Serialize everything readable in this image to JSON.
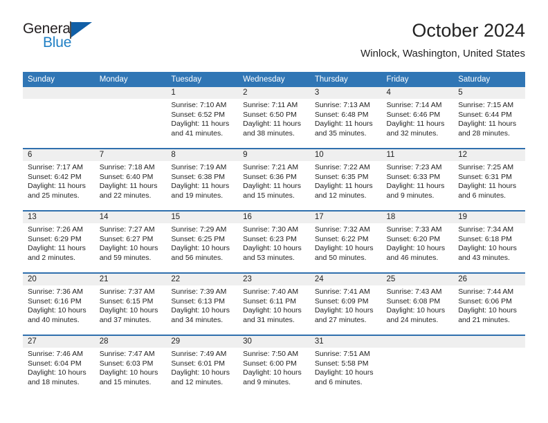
{
  "brand": {
    "name_part1": "General",
    "name_part2": "Blue",
    "flag_icon": "flag-triangle-icon"
  },
  "header": {
    "month_title": "October 2024",
    "location": "Winlock, Washington, United States"
  },
  "colors": {
    "header_blue": "#3076b5",
    "divider_blue": "#2f6fad",
    "daynum_band": "#efefef",
    "brand_blue": "#1f7fc4",
    "text": "#222222"
  },
  "calendar": {
    "weekday_headers": [
      "Sunday",
      "Monday",
      "Tuesday",
      "Wednesday",
      "Thursday",
      "Friday",
      "Saturday"
    ],
    "weeks": [
      [
        {
          "day": "",
          "empty": true,
          "sunrise": "",
          "sunset": "",
          "daylight": ""
        },
        {
          "day": "",
          "empty": true,
          "sunrise": "",
          "sunset": "",
          "daylight": ""
        },
        {
          "day": "1",
          "sunrise": "Sunrise: 7:10 AM",
          "sunset": "Sunset: 6:52 PM",
          "daylight": "Daylight: 11 hours and 41 minutes."
        },
        {
          "day": "2",
          "sunrise": "Sunrise: 7:11 AM",
          "sunset": "Sunset: 6:50 PM",
          "daylight": "Daylight: 11 hours and 38 minutes."
        },
        {
          "day": "3",
          "sunrise": "Sunrise: 7:13 AM",
          "sunset": "Sunset: 6:48 PM",
          "daylight": "Daylight: 11 hours and 35 minutes."
        },
        {
          "day": "4",
          "sunrise": "Sunrise: 7:14 AM",
          "sunset": "Sunset: 6:46 PM",
          "daylight": "Daylight: 11 hours and 32 minutes."
        },
        {
          "day": "5",
          "sunrise": "Sunrise: 7:15 AM",
          "sunset": "Sunset: 6:44 PM",
          "daylight": "Daylight: 11 hours and 28 minutes."
        }
      ],
      [
        {
          "day": "6",
          "sunrise": "Sunrise: 7:17 AM",
          "sunset": "Sunset: 6:42 PM",
          "daylight": "Daylight: 11 hours and 25 minutes."
        },
        {
          "day": "7",
          "sunrise": "Sunrise: 7:18 AM",
          "sunset": "Sunset: 6:40 PM",
          "daylight": "Daylight: 11 hours and 22 minutes."
        },
        {
          "day": "8",
          "sunrise": "Sunrise: 7:19 AM",
          "sunset": "Sunset: 6:38 PM",
          "daylight": "Daylight: 11 hours and 19 minutes."
        },
        {
          "day": "9",
          "sunrise": "Sunrise: 7:21 AM",
          "sunset": "Sunset: 6:36 PM",
          "daylight": "Daylight: 11 hours and 15 minutes."
        },
        {
          "day": "10",
          "sunrise": "Sunrise: 7:22 AM",
          "sunset": "Sunset: 6:35 PM",
          "daylight": "Daylight: 11 hours and 12 minutes."
        },
        {
          "day": "11",
          "sunrise": "Sunrise: 7:23 AM",
          "sunset": "Sunset: 6:33 PM",
          "daylight": "Daylight: 11 hours and 9 minutes."
        },
        {
          "day": "12",
          "sunrise": "Sunrise: 7:25 AM",
          "sunset": "Sunset: 6:31 PM",
          "daylight": "Daylight: 11 hours and 6 minutes."
        }
      ],
      [
        {
          "day": "13",
          "sunrise": "Sunrise: 7:26 AM",
          "sunset": "Sunset: 6:29 PM",
          "daylight": "Daylight: 11 hours and 2 minutes."
        },
        {
          "day": "14",
          "sunrise": "Sunrise: 7:27 AM",
          "sunset": "Sunset: 6:27 PM",
          "daylight": "Daylight: 10 hours and 59 minutes."
        },
        {
          "day": "15",
          "sunrise": "Sunrise: 7:29 AM",
          "sunset": "Sunset: 6:25 PM",
          "daylight": "Daylight: 10 hours and 56 minutes."
        },
        {
          "day": "16",
          "sunrise": "Sunrise: 7:30 AM",
          "sunset": "Sunset: 6:23 PM",
          "daylight": "Daylight: 10 hours and 53 minutes."
        },
        {
          "day": "17",
          "sunrise": "Sunrise: 7:32 AM",
          "sunset": "Sunset: 6:22 PM",
          "daylight": "Daylight: 10 hours and 50 minutes."
        },
        {
          "day": "18",
          "sunrise": "Sunrise: 7:33 AM",
          "sunset": "Sunset: 6:20 PM",
          "daylight": "Daylight: 10 hours and 46 minutes."
        },
        {
          "day": "19",
          "sunrise": "Sunrise: 7:34 AM",
          "sunset": "Sunset: 6:18 PM",
          "daylight": "Daylight: 10 hours and 43 minutes."
        }
      ],
      [
        {
          "day": "20",
          "sunrise": "Sunrise: 7:36 AM",
          "sunset": "Sunset: 6:16 PM",
          "daylight": "Daylight: 10 hours and 40 minutes."
        },
        {
          "day": "21",
          "sunrise": "Sunrise: 7:37 AM",
          "sunset": "Sunset: 6:15 PM",
          "daylight": "Daylight: 10 hours and 37 minutes."
        },
        {
          "day": "22",
          "sunrise": "Sunrise: 7:39 AM",
          "sunset": "Sunset: 6:13 PM",
          "daylight": "Daylight: 10 hours and 34 minutes."
        },
        {
          "day": "23",
          "sunrise": "Sunrise: 7:40 AM",
          "sunset": "Sunset: 6:11 PM",
          "daylight": "Daylight: 10 hours and 31 minutes."
        },
        {
          "day": "24",
          "sunrise": "Sunrise: 7:41 AM",
          "sunset": "Sunset: 6:09 PM",
          "daylight": "Daylight: 10 hours and 27 minutes."
        },
        {
          "day": "25",
          "sunrise": "Sunrise: 7:43 AM",
          "sunset": "Sunset: 6:08 PM",
          "daylight": "Daylight: 10 hours and 24 minutes."
        },
        {
          "day": "26",
          "sunrise": "Sunrise: 7:44 AM",
          "sunset": "Sunset: 6:06 PM",
          "daylight": "Daylight: 10 hours and 21 minutes."
        }
      ],
      [
        {
          "day": "27",
          "sunrise": "Sunrise: 7:46 AM",
          "sunset": "Sunset: 6:04 PM",
          "daylight": "Daylight: 10 hours and 18 minutes."
        },
        {
          "day": "28",
          "sunrise": "Sunrise: 7:47 AM",
          "sunset": "Sunset: 6:03 PM",
          "daylight": "Daylight: 10 hours and 15 minutes."
        },
        {
          "day": "29",
          "sunrise": "Sunrise: 7:49 AM",
          "sunset": "Sunset: 6:01 PM",
          "daylight": "Daylight: 10 hours and 12 minutes."
        },
        {
          "day": "30",
          "sunrise": "Sunrise: 7:50 AM",
          "sunset": "Sunset: 6:00 PM",
          "daylight": "Daylight: 10 hours and 9 minutes."
        },
        {
          "day": "31",
          "sunrise": "Sunrise: 7:51 AM",
          "sunset": "Sunset: 5:58 PM",
          "daylight": "Daylight: 10 hours and 6 minutes."
        },
        {
          "day": "",
          "empty": true,
          "sunrise": "",
          "sunset": "",
          "daylight": ""
        },
        {
          "day": "",
          "empty": true,
          "sunrise": "",
          "sunset": "",
          "daylight": ""
        }
      ]
    ]
  }
}
